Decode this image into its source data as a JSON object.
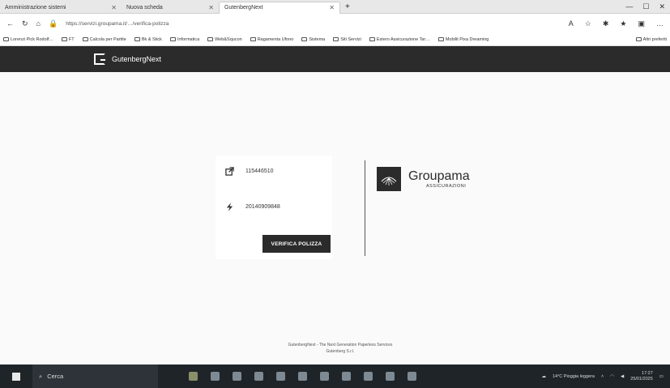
{
  "browser": {
    "tabs": [
      {
        "title": "Amministrazione sistemi"
      },
      {
        "title": "Nuova scheda"
      },
      {
        "title": "GutenbergNext"
      }
    ],
    "url": "https://servizi.groupama.it/…/verifica-polizza",
    "bookmarks": [
      "Lorenzi Pick Rodolf…",
      "FT",
      "Calcola per Partite",
      "Bk & Stick",
      "Informatica",
      "Web&Squcon",
      "Ragamenta Ufono",
      "Sistema",
      "Siti Servizi",
      "Estero Assicurazione Tar…",
      "Mobilit Pixa Dreaming",
      "Altri preferiti"
    ]
  },
  "app": {
    "name": "GutenbergNext"
  },
  "card": {
    "policy_number": "115446510",
    "date_value": "20140909848",
    "verify_label": "VERIFICA POLIZZA"
  },
  "brand": {
    "name": "Groupama",
    "subtitle": "ASSICURAZIONI"
  },
  "footer": {
    "line1": "GutenbergNext - The Next Generation Paperless Services",
    "line2": "Gutenberg S.r.l."
  },
  "taskbar": {
    "search_placeholder": "Cerca",
    "weather": "14°C Pioggia leggera",
    "time": "17:27",
    "date": "25/01/2025"
  }
}
